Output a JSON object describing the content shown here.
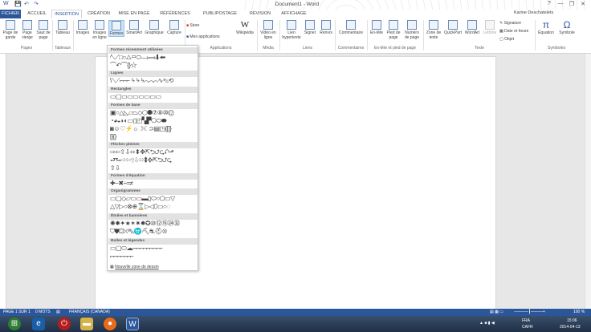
{
  "titlebar": {
    "title": "Document1 - Word",
    "qat_save": "💾",
    "qat_undo": "↶",
    "qat_redo": "↷",
    "min": "—",
    "restore": "❐",
    "close": "✕",
    "help": "?"
  },
  "tabs": [
    "FICHIER",
    "ACCUEIL",
    "INSERTION",
    "CRÉATION",
    "MISE EN PAGE",
    "RÉFÉRENCES",
    "PUBLIPOSTAGE",
    "RÉVISION",
    "AFFICHAGE"
  ],
  "user": "Karine Deschatelets",
  "ribbon": {
    "buttons": [
      "Page de garde",
      "Page vierge",
      "Saut de page",
      "Tableau",
      "Images",
      "Images en ligne",
      "Formes",
      "SmartArt",
      "Graphique",
      "Capture",
      "Store",
      "Mes applications",
      "Wikipédia",
      "Vidéo en ligne",
      "Lien hypertexte",
      "Signet",
      "Renvoi",
      "Commentaire",
      "En-tête",
      "Pied de page",
      "Numéro de page",
      "Zone de texte",
      "QuickPart",
      "WordArt",
      "Lettrine",
      "Signature",
      "Date et heure",
      "Objet",
      "Équation",
      "Symbole"
    ],
    "groups": [
      "Pages",
      "Tableaux",
      "Applications",
      "Média",
      "Liens",
      "Commentaires",
      "En-tête et pied de page",
      "Texte",
      "Symboles"
    ]
  },
  "shapes_menu": {
    "sections": [
      "Formes récemment utilisées",
      "Lignes",
      "Rectangles",
      "Formes de base",
      "Flèches pleines",
      "Formes d'équation",
      "Organigrammes",
      "Étoiles et bannières",
      "Bulles et légendes"
    ],
    "new_canvas": "Nouvelle zone de dessin"
  },
  "statusbar": {
    "page": "PAGE 1 SUR 1",
    "words": "0 MOTS",
    "language": "FRANÇAIS (CANADA)",
    "zoom": "100 %"
  },
  "tray": {
    "lang": "FRA",
    "region": "CAFR",
    "time": "15:06",
    "date": "2014-04-13"
  }
}
